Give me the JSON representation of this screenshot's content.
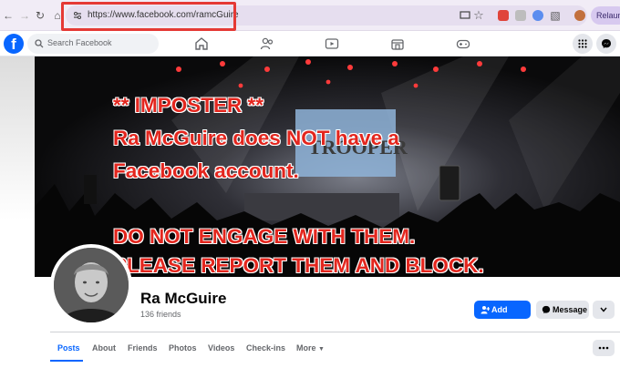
{
  "browser": {
    "url": "https://www.facebook.com/ramcGuire",
    "relaunch_label": "Relaunc",
    "highlight_color": "#e53935"
  },
  "facebook": {
    "logo": "f",
    "search_placeholder": "Search Facebook",
    "brand_color": "#0866ff",
    "nav_icons": [
      "home-icon",
      "friends-icon",
      "video-icon",
      "marketplace-icon",
      "gaming-icon"
    ],
    "right_icons": [
      "menu-grid-icon",
      "messenger-icon"
    ]
  },
  "cover": {
    "warning_lines": [
      "** IMPOSTER **",
      "Ra McGuire does NOT have a",
      "Facebook account.",
      "DO NOT ENGAGE WITH THEM.",
      "PLEASE REPORT THEM AND BLOCK."
    ],
    "screen_text": "TROOPER",
    "warning_color": "#e3261e"
  },
  "profile": {
    "name": "Ra McGuire",
    "friends": "136 friends",
    "add_friend_label": "Add friend",
    "message_label": "Message"
  },
  "tabs": [
    "Posts",
    "About",
    "Friends",
    "Photos",
    "Videos",
    "Check-ins",
    "More"
  ]
}
